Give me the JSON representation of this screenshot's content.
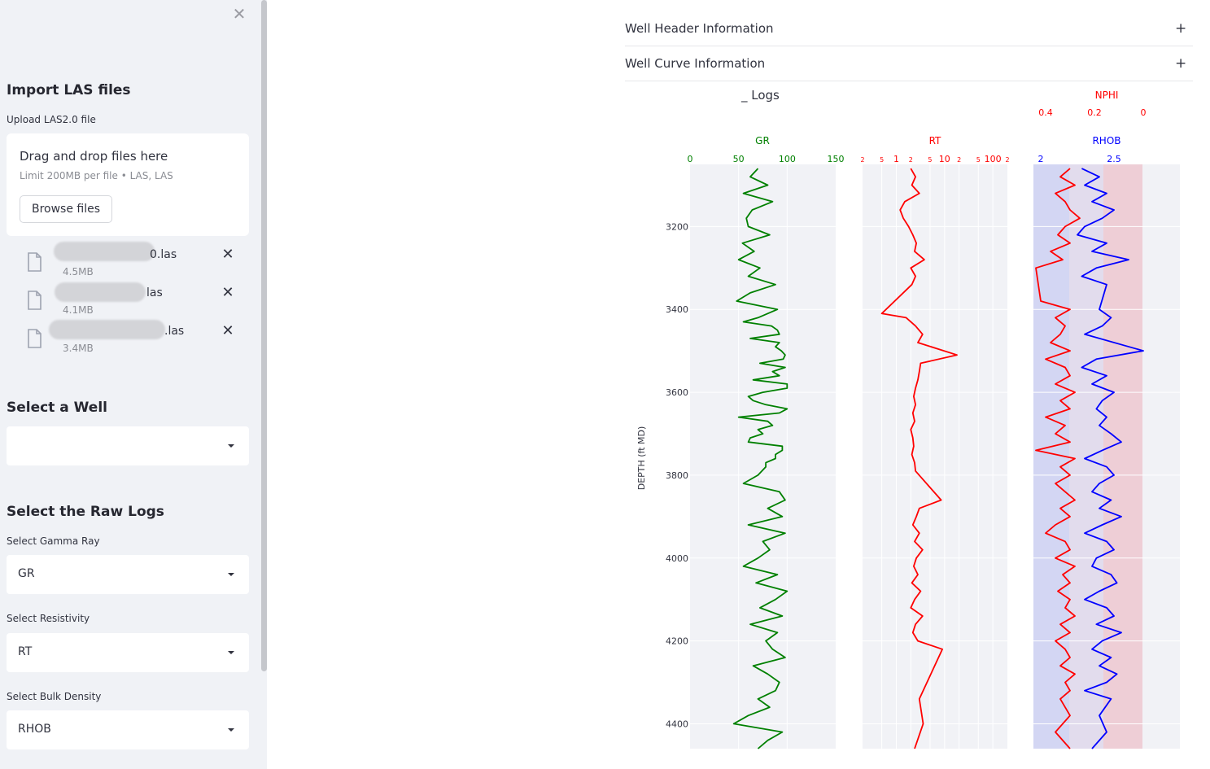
{
  "sidebar": {
    "close_icon": "✕",
    "import_heading": "Import LAS files",
    "upload_label": "Upload LAS2.0 file",
    "dropzone": {
      "title": "Drag and drop files here",
      "limit": "Limit 200MB per file • LAS, LAS",
      "browse_label": "Browse files"
    },
    "files": [
      {
        "name_suffix": "0.las",
        "size": "4.5MB"
      },
      {
        "name_suffix": "las",
        "size": "4.1MB"
      },
      {
        "name_suffix": ".las",
        "size": "3.4MB"
      }
    ],
    "well_heading": "Select a Well",
    "well_value": "",
    "raw_logs_heading": "Select the Raw Logs",
    "gamma_label": "Select Gamma Ray",
    "gamma_value": "GR",
    "resistivity_label": "Select Resistivity",
    "resistivity_value": "RT",
    "density_label": "Select Bulk Density",
    "density_value": "RHOB"
  },
  "main": {
    "expanders": [
      {
        "title": "Well Header Information",
        "icon": "+"
      },
      {
        "title": "Well Curve Information",
        "icon": "+"
      }
    ]
  },
  "chart_data": {
    "type": "line",
    "title": "_ Logs",
    "ylabel": "DEPTH (ft MD)",
    "ylim": [
      4460,
      3050
    ],
    "ytick_labels": [
      "3200",
      "3400",
      "3600",
      "3800",
      "4000",
      "4200",
      "4400"
    ],
    "tracks": [
      {
        "name": "GR",
        "color": "#008000",
        "scale": "linear",
        "xlim": [
          0,
          150
        ],
        "tick_labels": [
          "0",
          "50",
          "100",
          "150"
        ]
      },
      {
        "name": "RT",
        "color": "#ff0000",
        "scale": "log",
        "xlim": [
          0.2,
          200
        ],
        "tick_labels": [
          "2",
          "5",
          "1",
          "2",
          "5",
          "10",
          "2",
          "5",
          "100",
          "2"
        ]
      },
      {
        "name": "NPHI",
        "color": "#ff0000",
        "scale": "linear",
        "xlim": [
          0.45,
          -0.15
        ],
        "tick_labels": [
          "0.4",
          "0.2",
          "0"
        ]
      },
      {
        "name": "RHOB",
        "color": "#0000ff",
        "scale": "linear",
        "xlim": [
          1.95,
          2.95
        ],
        "tick_labels": [
          "2",
          "2.5"
        ]
      }
    ],
    "series": [
      {
        "name": "GR",
        "x": [
          70,
          62,
          80,
          55,
          85,
          64,
          58,
          60,
          82,
          54,
          66,
          50,
          72,
          60,
          88,
          62,
          48,
          90,
          70,
          84,
          92,
          92,
          94,
          96,
          98,
          92,
          100,
          75,
          65,
          100,
          50,
          85,
          75,
          60,
          95,
          88,
          78,
          70,
          55,
          92,
          98,
          80,
          95,
          60,
          98,
          75,
          82,
          70,
          55,
          90,
          68,
          100,
          88,
          72,
          95,
          62,
          90,
          78,
          85,
          98,
          65,
          80,
          92,
          88,
          70,
          82,
          60,
          45,
          95,
          80,
          70,
          55,
          90,
          62,
          88,
          98,
          72,
          85,
          65,
          100,
          60,
          78,
          92,
          80,
          70,
          62,
          95,
          88,
          78
        ],
        "y": [
          3060,
          3080,
          3100,
          3120,
          3140,
          3160,
          3180,
          3200,
          3220,
          3240,
          3260,
          3280,
          3300,
          3320,
          3340,
          3360,
          3380,
          3400,
          3420,
          3440,
          3460,
          3480,
          3500,
          3520,
          3540,
          3560,
          3580,
          3600,
          3620,
          3640,
          3660,
          3680,
          3700,
          3720,
          3740,
          3760,
          3780,
          3800,
          3820,
          3840,
          3860,
          3880,
          3900,
          3920,
          3940,
          3960,
          3980,
          4000,
          4020,
          4040,
          4060,
          4080,
          4100,
          4120,
          4140,
          4160,
          4180,
          4200,
          4220,
          4240,
          4260,
          4280,
          4300,
          4320,
          4340,
          4360,
          4380,
          4400,
          4420,
          4440,
          4460,
          3430,
          3450,
          3470,
          3490,
          3510,
          3530,
          3550,
          3570,
          3590,
          3610,
          3630,
          3650,
          3670,
          3690,
          3710,
          3730,
          3750,
          3770
        ]
      },
      {
        "name": "RT",
        "x": [
          2.0,
          2.5,
          2.1,
          3.0,
          1.5,
          1.2,
          1.4,
          1.8,
          2.2,
          2.6,
          2.4,
          3.8,
          2.0,
          2.5,
          2.1,
          0.5,
          1.6,
          2.5,
          3.5,
          2.8,
          18,
          3.2,
          3.0,
          2.8,
          2.5,
          2.3,
          2.5,
          2.2,
          2.4,
          2.0,
          2.2,
          2.3,
          2.1,
          2.4,
          2.5,
          8.5,
          3.0,
          2.6,
          2.2,
          3.0,
          2.4,
          3.5,
          2.6,
          2.3,
          2.8,
          2.1,
          3.2,
          2.4,
          2.0,
          3.5,
          2.5,
          2.2,
          2.8,
          9.0,
          3.0,
          3.6,
          2.4
        ],
        "y": [
          3060,
          3080,
          3100,
          3120,
          3140,
          3160,
          3180,
          3200,
          3220,
          3240,
          3260,
          3280,
          3300,
          3320,
          3340,
          3410,
          3420,
          3440,
          3460,
          3480,
          3510,
          3530,
          3550,
          3570,
          3590,
          3610,
          3630,
          3650,
          3670,
          3690,
          3710,
          3730,
          3750,
          3770,
          3790,
          3860,
          3880,
          3900,
          3920,
          3940,
          3960,
          3980,
          4000,
          4020,
          4040,
          4060,
          4080,
          4100,
          4120,
          4140,
          4160,
          4180,
          4200,
          4220,
          4340,
          4400,
          4460
        ]
      },
      {
        "name": "NPHI",
        "x": [
          0.3,
          0.34,
          0.28,
          0.36,
          0.32,
          0.3,
          0.26,
          0.32,
          0.35,
          0.3,
          0.38,
          0.33,
          0.44,
          0.42,
          0.3,
          0.36,
          0.32,
          0.34,
          0.38,
          0.3,
          0.4,
          0.32,
          0.3,
          0.36,
          0.28,
          0.34,
          0.3,
          0.4,
          0.32,
          0.36,
          0.3,
          0.44,
          0.28,
          0.34,
          0.3,
          0.36,
          0.32,
          0.28,
          0.34,
          0.3,
          0.36,
          0.4,
          0.32,
          0.3,
          0.36,
          0.28,
          0.33,
          0.3,
          0.35,
          0.3,
          0.32,
          0.28,
          0.34,
          0.3,
          0.36,
          0.32,
          0.3,
          0.34,
          0.28,
          0.32,
          0.3,
          0.34,
          0.3,
          0.36,
          0.3
        ],
        "y": [
          3060,
          3080,
          3100,
          3120,
          3140,
          3160,
          3180,
          3200,
          3220,
          3240,
          3260,
          3280,
          3300,
          3380,
          3400,
          3420,
          3440,
          3460,
          3480,
          3500,
          3520,
          3540,
          3560,
          3580,
          3600,
          3620,
          3640,
          3660,
          3680,
          3700,
          3720,
          3740,
          3760,
          3780,
          3800,
          3820,
          3840,
          3860,
          3880,
          3900,
          3920,
          3940,
          3960,
          3980,
          4000,
          4020,
          4040,
          4060,
          4080,
          4100,
          4120,
          4140,
          4160,
          4180,
          4200,
          4220,
          4240,
          4260,
          4280,
          4300,
          4320,
          4340,
          4380,
          4420,
          4460
        ]
      },
      {
        "name": "RHOB",
        "x": [
          2.28,
          2.4,
          2.3,
          2.45,
          2.35,
          2.5,
          2.42,
          2.3,
          2.25,
          2.45,
          2.35,
          2.6,
          2.38,
          2.28,
          2.45,
          2.4,
          2.48,
          2.42,
          2.3,
          2.7,
          2.38,
          2.28,
          2.45,
          2.35,
          2.5,
          2.42,
          2.38,
          2.45,
          2.4,
          2.48,
          2.55,
          2.42,
          2.3,
          2.45,
          2.5,
          2.4,
          2.35,
          2.48,
          2.4,
          2.55,
          2.42,
          2.3,
          2.45,
          2.5,
          2.38,
          2.35,
          2.48,
          2.52,
          2.4,
          2.3,
          2.45,
          2.5,
          2.38,
          2.55,
          2.42,
          2.35,
          2.48,
          2.4,
          2.52,
          2.45,
          2.3,
          2.48,
          2.4,
          2.45,
          2.35
        ],
        "y": [
          3060,
          3080,
          3100,
          3120,
          3140,
          3160,
          3180,
          3200,
          3220,
          3240,
          3260,
          3280,
          3300,
          3320,
          3340,
          3400,
          3420,
          3440,
          3460,
          3500,
          3520,
          3540,
          3560,
          3580,
          3600,
          3620,
          3640,
          3660,
          3680,
          3700,
          3720,
          3740,
          3760,
          3780,
          3800,
          3820,
          3840,
          3860,
          3880,
          3900,
          3920,
          3940,
          3960,
          3980,
          4000,
          4020,
          4040,
          4060,
          4080,
          4100,
          4120,
          4140,
          4160,
          4180,
          4200,
          4220,
          4240,
          4260,
          4280,
          4300,
          4320,
          4340,
          4380,
          4420,
          4460
        ]
      }
    ]
  }
}
